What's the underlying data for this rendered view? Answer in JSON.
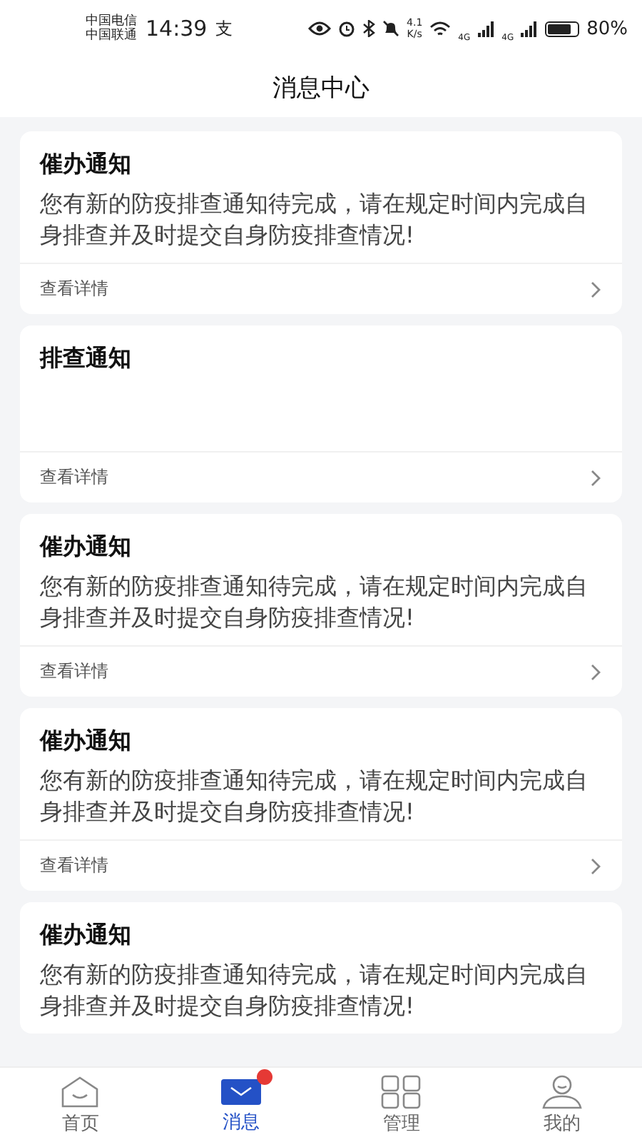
{
  "status_bar": {
    "carriers": [
      "中国电信",
      "中国联通"
    ],
    "time": "14:39",
    "app_glyph": "支",
    "speed": [
      "4.1",
      "K/s"
    ],
    "network_labels": [
      "4G",
      "4G"
    ],
    "battery_text": "80%"
  },
  "header": {
    "title": "消息中心"
  },
  "messages": [
    {
      "title": "催办通知",
      "body": "您有新的防疫排查通知待完成，请在规定时间内完成自身排查并及时提交自身防疫排查情况!",
      "link": "查看详情"
    },
    {
      "title": "排查通知",
      "link": "查看详情"
    },
    {
      "title": "催办通知",
      "body": "您有新的防疫排查通知待完成，请在规定时间内完成自身排查并及时提交自身防疫排查情况!",
      "link": "查看详情"
    },
    {
      "title": "催办通知",
      "body": "您有新的防疫排查通知待完成，请在规定时间内完成自身排查并及时提交自身防疫排查情况!",
      "link": "查看详情"
    },
    {
      "title": "催办通知",
      "body": "您有新的防疫排查通知待完成，请在规定时间内完成自身排查并及时提交自身防疫排查情况!"
    }
  ],
  "tab_bar": [
    {
      "kind": "home",
      "label": "首页",
      "selected": false,
      "badge": false
    },
    {
      "kind": "messages",
      "label": "消息",
      "selected": true,
      "badge": true
    },
    {
      "kind": "manage",
      "label": "管理",
      "selected": false,
      "badge": false
    },
    {
      "kind": "profile",
      "label": "我的",
      "selected": false,
      "badge": false
    }
  ]
}
